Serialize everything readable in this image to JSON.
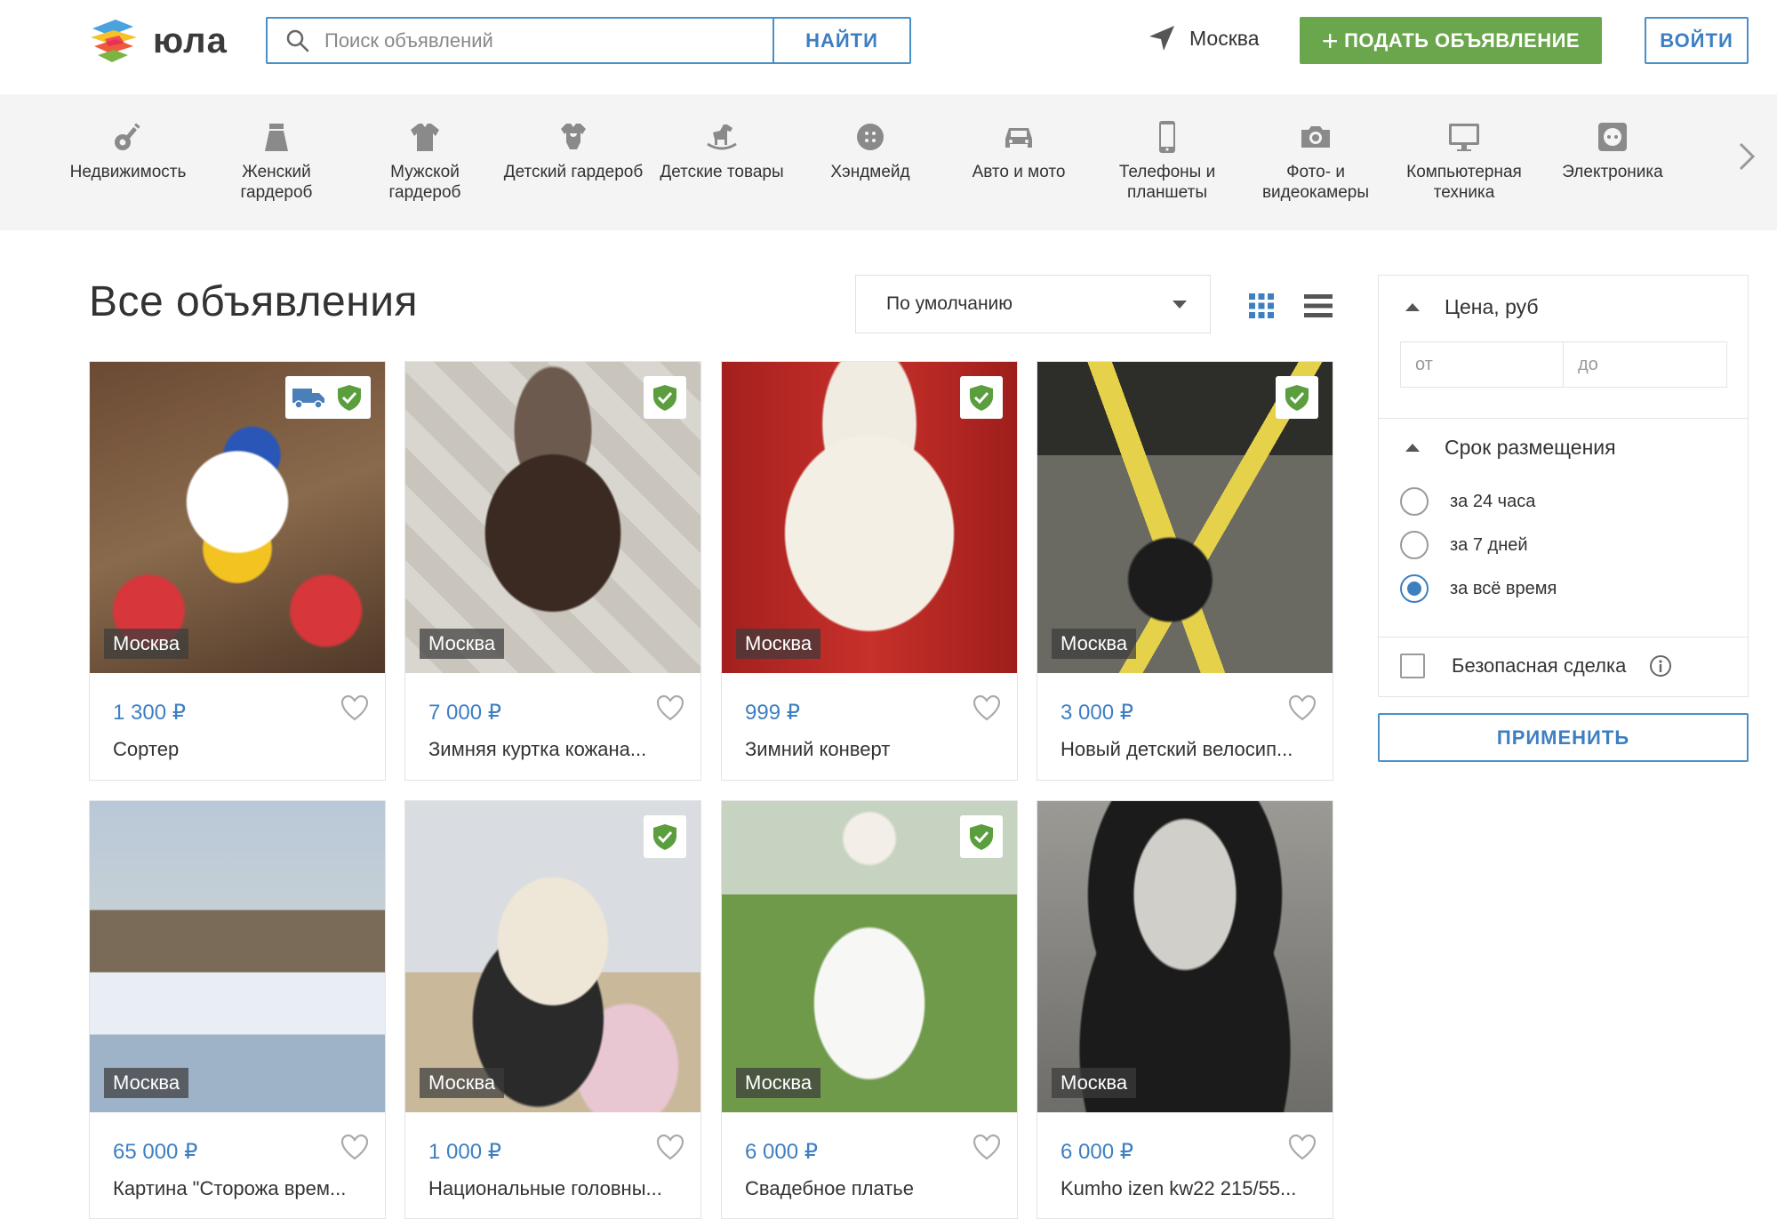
{
  "header": {
    "logo_text": "юла",
    "search_placeholder": "Поиск объявлений",
    "search_button": "НАЙТИ",
    "location": "Москва",
    "post_button": "ПОДАТЬ ОБЪЯВЛЕНИЕ",
    "login_button": "ВОЙТИ"
  },
  "categories": [
    {
      "label": "Недвижимость",
      "icon": "key-icon"
    },
    {
      "label": "Женский гардероб",
      "icon": "skirt-icon"
    },
    {
      "label": "Мужской гардероб",
      "icon": "shirt-icon"
    },
    {
      "label": "Детский гардероб",
      "icon": "bodysuit-icon"
    },
    {
      "label": "Детские товары",
      "icon": "rocking-horse-icon"
    },
    {
      "label": "Хэндмейд",
      "icon": "button-icon"
    },
    {
      "label": "Авто и мото",
      "icon": "car-icon"
    },
    {
      "label": "Телефоны и планшеты",
      "icon": "phone-icon"
    },
    {
      "label": "Фото- и видеокамеры",
      "icon": "camera-icon"
    },
    {
      "label": "Компьютерная техника",
      "icon": "monitor-icon"
    },
    {
      "label": "Электроника",
      "icon": "socket-icon"
    }
  ],
  "main": {
    "title": "Все объявления",
    "sort_value": "По умолчанию"
  },
  "listings": [
    {
      "city": "Москва",
      "price": "1 300 ₽",
      "name": "Сортер",
      "verified": true,
      "delivery": true
    },
    {
      "city": "Москва",
      "price": "7 000 ₽",
      "name": "Зимняя куртка кожана...",
      "verified": true,
      "delivery": false
    },
    {
      "city": "Москва",
      "price": "999 ₽",
      "name": "Зимний конверт",
      "verified": true,
      "delivery": false
    },
    {
      "city": "Москва",
      "price": "3 000 ₽",
      "name": "Новый детский велосип...",
      "verified": true,
      "delivery": false
    },
    {
      "city": "Москва",
      "price": "65 000 ₽",
      "name": "Картина \"Сторожа врем...",
      "verified": false,
      "delivery": false
    },
    {
      "city": "Москва",
      "price": "1 000 ₽",
      "name": "Национальные головны...",
      "verified": true,
      "delivery": false
    },
    {
      "city": "Москва",
      "price": "6 000 ₽",
      "name": "Свадебное платье",
      "verified": true,
      "delivery": false
    },
    {
      "city": "Москва",
      "price": "6 000 ₽",
      "name": "Kumho izen kw22 215/55...",
      "verified": false,
      "delivery": false
    }
  ],
  "filters": {
    "price_title": "Цена, руб",
    "price_from_placeholder": "от",
    "price_to_placeholder": "до",
    "period_title": "Срок размещения",
    "period_options": [
      "за 24 часа",
      "за 7 дней",
      "за всё время"
    ],
    "period_selected": "за всё время",
    "safe_deal_label": "Безопасная сделка",
    "apply_button": "ПРИМЕНИТЬ"
  },
  "colors": {
    "accent_blue": "#3d7fc1",
    "brand_green": "#6aa64b",
    "verified_green": "#5a9e3e"
  }
}
